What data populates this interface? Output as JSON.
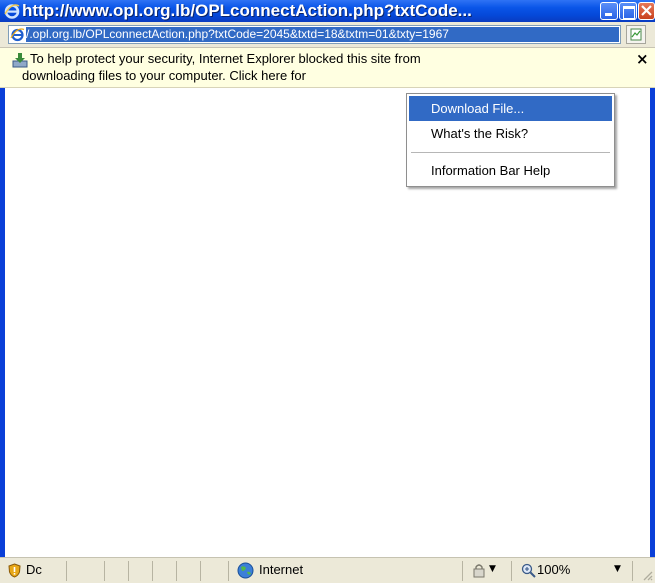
{
  "window": {
    "title": "http://www.opl.org.lb/OPLconnectAction.php?txtCode..."
  },
  "address_bar": {
    "url_visible": "/.opl.org.lb/OPLconnectAction.php?txtCode=2045&txtd=18&txtm=01&txty=1967",
    "icon": "ie-page-icon"
  },
  "info_bar": {
    "line1": "To help protect your security, Internet Explorer blocked this site from",
    "line2": "downloading files to your computer. Click here for",
    "close_label": "×",
    "icon": "download-blocked-icon"
  },
  "context_menu": {
    "items": [
      {
        "label": "Download File...",
        "selected": true
      },
      {
        "label": "What's the Risk?",
        "selected": false
      },
      {
        "label": "Information Bar Help",
        "selected": false
      }
    ]
  },
  "status_bar": {
    "status_text": "Dc",
    "zone": "Internet",
    "zoom": "100%"
  },
  "colors": {
    "title_bar": "#0a55e8",
    "selection": "#316ac5",
    "info_bar_bg": "#ffffe1",
    "chrome": "#ece9d8"
  }
}
